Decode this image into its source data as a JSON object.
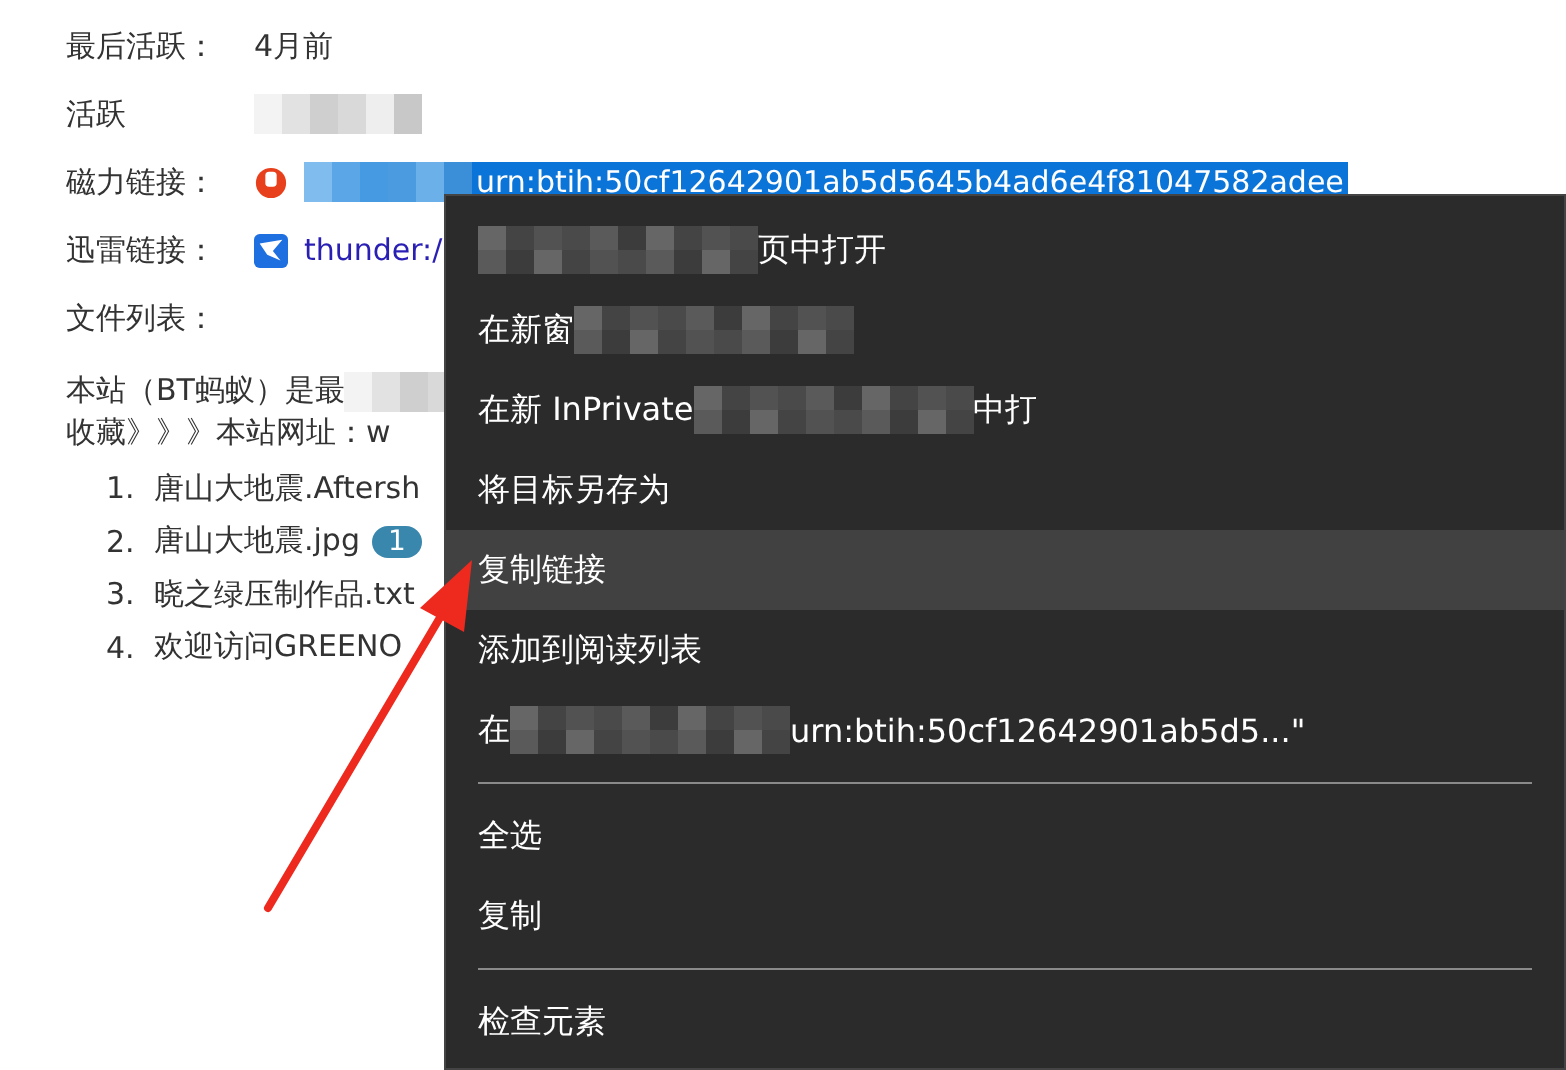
{
  "info_rows": [
    {
      "label": "最后活跃：",
      "segments": [
        {
          "kind": "text",
          "text": "4月前"
        }
      ]
    },
    {
      "label": "活跃",
      "segments": [
        {
          "kind": "mosaic"
        }
      ]
    },
    {
      "label": "磁力链接：",
      "kind": "magnet",
      "segments": [
        {
          "kind": "mosaic"
        },
        {
          "kind": "selected-text",
          "text": "urn:btih:50cf12642901ab5d5645b4ad6e4f81047582adee"
        }
      ]
    },
    {
      "label": "迅雷链接：",
      "kind": "thunder",
      "segments": [
        {
          "kind": "link",
          "text": "thunder:/"
        }
      ]
    },
    {
      "label": "文件列表：",
      "segments": []
    }
  ],
  "notice": [
    {
      "segments": [
        {
          "kind": "text",
          "text": "本站（BT蚂蚁）是最"
        },
        {
          "kind": "mosaic"
        }
      ]
    },
    {
      "segments": [
        {
          "kind": "text",
          "text": "收藏》》》本站网址：w"
        }
      ]
    }
  ],
  "files": [
    {
      "number": "1.",
      "name": "唐山大地震.Aftersh"
    },
    {
      "number": "2.",
      "name": "唐山大地震.jpg",
      "badge": "1"
    },
    {
      "number": "3.",
      "name": "晓之绿压制作品.txt"
    },
    {
      "number": "4.",
      "name": "欢迎访问GREENO"
    }
  ],
  "context_menu": [
    {
      "kind": "item",
      "selected": false,
      "segments": [
        {
          "kind": "mosaic"
        },
        {
          "kind": "text",
          "text": "页中打开"
        }
      ]
    },
    {
      "kind": "item",
      "selected": false,
      "segments": [
        {
          "kind": "text",
          "text": "在新窗"
        },
        {
          "kind": "mosaic"
        }
      ]
    },
    {
      "kind": "item",
      "selected": false,
      "segments": [
        {
          "kind": "text",
          "text": "在新 InPrivate"
        },
        {
          "kind": "mosaic"
        },
        {
          "kind": "text",
          "text": "中打"
        }
      ]
    },
    {
      "kind": "item",
      "selected": false,
      "segments": [
        {
          "kind": "text",
          "text": "将目标另存为"
        }
      ]
    },
    {
      "kind": "item",
      "selected": true,
      "segments": [
        {
          "kind": "text",
          "text": "复制链接"
        }
      ]
    },
    {
      "kind": "item",
      "selected": false,
      "segments": [
        {
          "kind": "text",
          "text": "添加到阅读列表"
        }
      ]
    },
    {
      "kind": "item",
      "selected": false,
      "segments": [
        {
          "kind": "text",
          "text": "在"
        },
        {
          "kind": "mosaic"
        },
        {
          "kind": "text",
          "text": "urn:btih:50cf12642901ab5d5...\""
        }
      ]
    },
    {
      "kind": "separator"
    },
    {
      "kind": "item",
      "selected": false,
      "segments": [
        {
          "kind": "text",
          "text": "全选"
        }
      ]
    },
    {
      "kind": "item",
      "selected": false,
      "segments": [
        {
          "kind": "text",
          "text": "复制"
        }
      ]
    },
    {
      "kind": "separator"
    },
    {
      "kind": "item",
      "selected": false,
      "segments": [
        {
          "kind": "text",
          "text": "检查元素"
        }
      ]
    }
  ],
  "annotation": {
    "kind": "arrow"
  }
}
